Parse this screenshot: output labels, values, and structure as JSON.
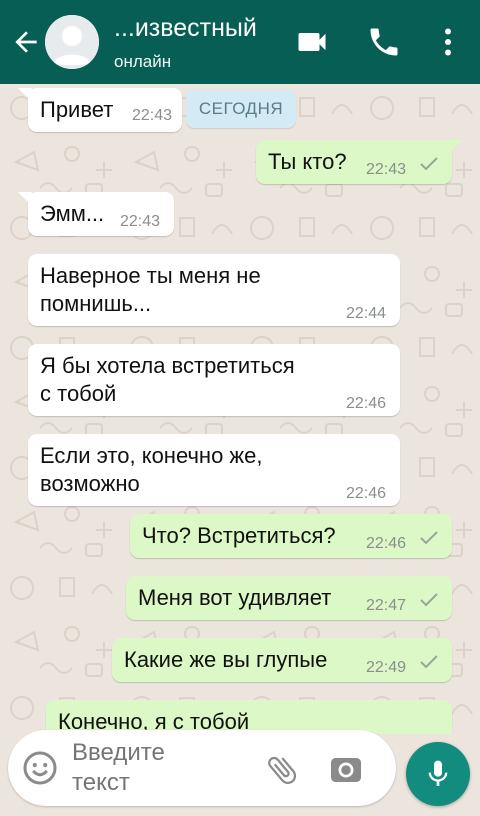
{
  "header": {
    "contact_name": "...известный",
    "status": "онлайн",
    "icons": [
      "back-arrow-icon",
      "avatar-placeholder",
      "videocam-icon",
      "phone-icon",
      "more-vert-icon"
    ]
  },
  "chat": {
    "date_chip": "СЕГОДНЯ",
    "messages": [
      {
        "dir": "in",
        "text": "Привет",
        "time": "22:43"
      },
      {
        "dir": "out",
        "text": "Ты кто?",
        "time": "22:43",
        "status": "sent"
      },
      {
        "dir": "in",
        "text": "Эмм...",
        "time": "22:43"
      },
      {
        "dir": "in",
        "lines": [
          "Наверное ты меня не",
          "помнишь..."
        ],
        "time": "22:44"
      },
      {
        "dir": "in",
        "lines": [
          "Я бы хотела встретиться",
          "с тобой"
        ],
        "time": "22:46"
      },
      {
        "dir": "in",
        "lines": [
          "Если это, конечно же,",
          "возможно"
        ],
        "time": "22:46"
      },
      {
        "dir": "out",
        "text": "Что? Встретиться?",
        "time": "22:46",
        "status": "sent"
      },
      {
        "dir": "out",
        "text": "Меня вот удивляет",
        "time": "22:47",
        "status": "sent"
      },
      {
        "dir": "out",
        "text": "Какие же вы глупые",
        "time": "22:49",
        "status": "sent"
      },
      {
        "dir": "out",
        "text": "Конечно, я с тобой",
        "partial": true
      }
    ]
  },
  "composer": {
    "placeholder": "Введите\nтекст",
    "icons": [
      "emoji-icon",
      "attach-icon",
      "camera-icon",
      "mic-icon"
    ]
  },
  "colors": {
    "header": "#075e54",
    "incoming": "#ffffff",
    "outgoing": "#dcf8c6",
    "wallpaper": "#ece5dd",
    "mic_button": "#128c7e",
    "date_chip": "#d4eaf4"
  }
}
